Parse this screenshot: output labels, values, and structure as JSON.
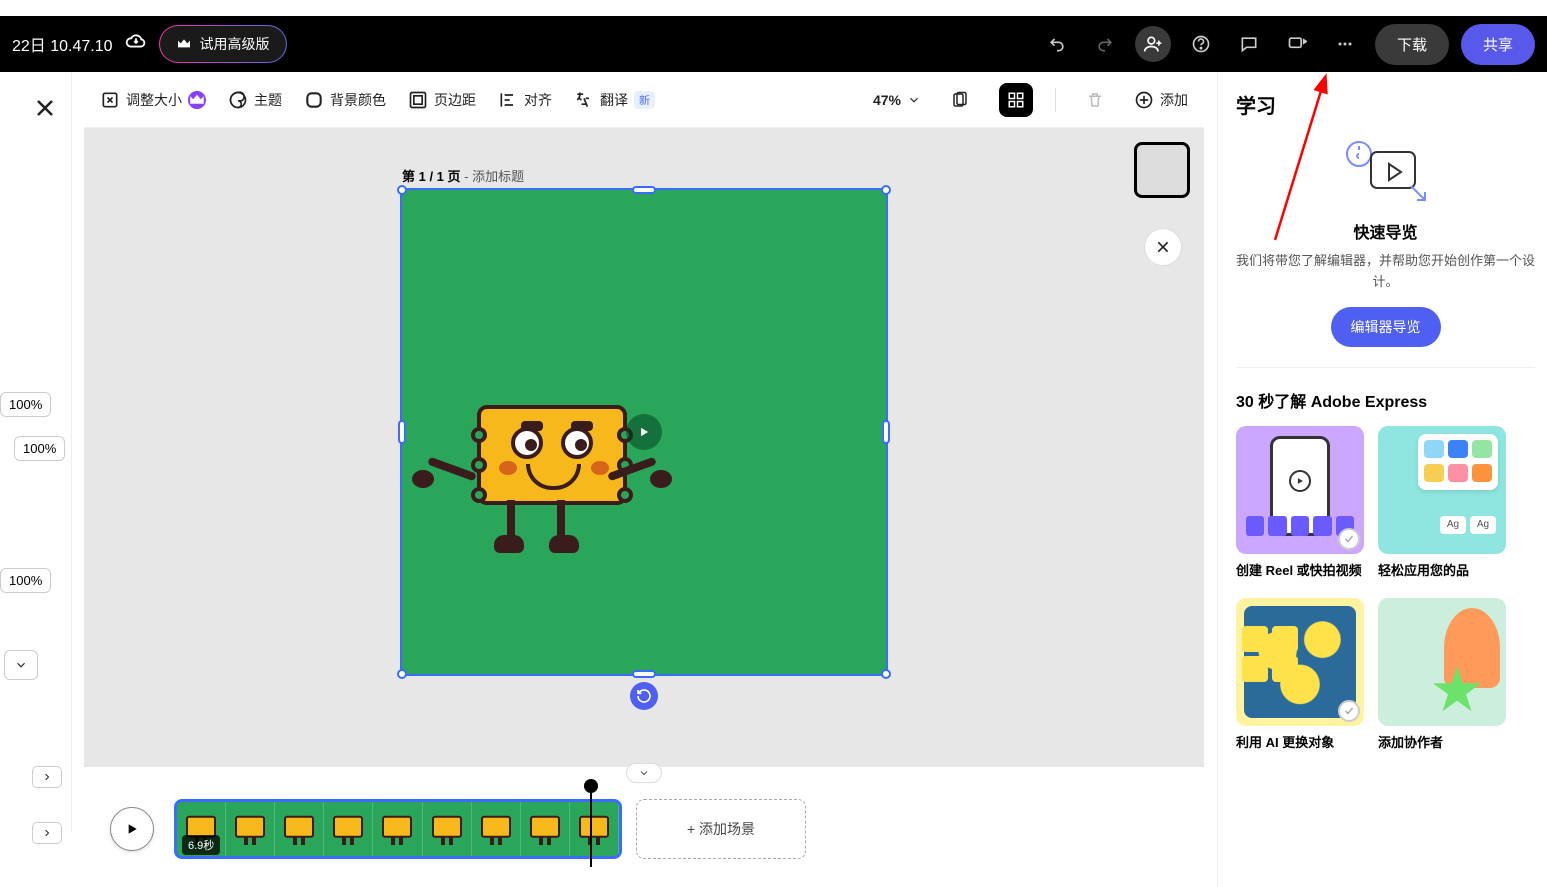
{
  "topbar": {
    "doc_title": "22日 10.47.10",
    "premium_label": "试用高级版",
    "download_label": "下载",
    "share_label": "共享"
  },
  "toolbar": {
    "resize": "调整大小",
    "theme": "主题",
    "bgcolor": "背景颜色",
    "margin": "页边距",
    "align": "对齐",
    "translate": "翻译",
    "translate_badge": "新",
    "zoom": "47%",
    "add": "添加"
  },
  "left": {
    "pct1": "100%",
    "pct2": "100%",
    "pct3": "100%"
  },
  "canvas": {
    "page_prefix": "第 1 / 1 页",
    "page_suffix": " - 添加标题"
  },
  "right": {
    "learn_title": "学习",
    "tour_title": "快速导览",
    "tour_desc": "我们将带您了解编辑器，并帮助您开始创作第一个设计。",
    "tour_btn": "编辑器导览",
    "section30": "30 秒了解 Adobe Express",
    "card1": "创建 Reel 或快拍视频",
    "card2": "轻松应用您的品",
    "card3": "利用 AI 更换对象",
    "card4": "添加协作者"
  },
  "timeline": {
    "duration": "6.9秒",
    "add_scene": "+ 添加场景"
  }
}
